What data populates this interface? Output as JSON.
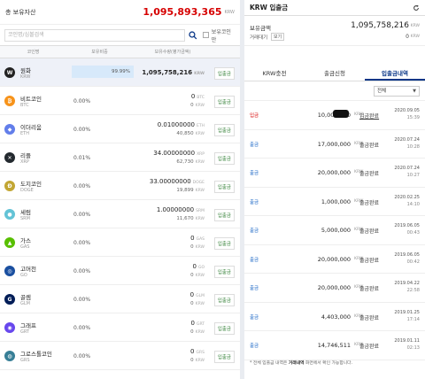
{
  "total": {
    "label": "총 보유자산",
    "amount": "1,095,893,365",
    "unit": "KRW"
  },
  "search": {
    "placeholder": "코인명/심볼검색",
    "checkbox_label": "보유코인만"
  },
  "columns": {
    "name": "코인명",
    "ratio": "보유비중",
    "quantity": "보유수량(평가금액)"
  },
  "deposit_label": "입출금",
  "coins": [
    {
      "name": "원화",
      "symbol": "KRW",
      "ratio": "99.99%",
      "qty": "1,095,758,216",
      "qty_unit": "KRW",
      "krw": "",
      "krw_unit": "",
      "icon_text": "W",
      "color": "#222222"
    },
    {
      "name": "비트코인",
      "symbol": "BTC",
      "ratio": "0.00%",
      "qty": "0",
      "qty_unit": "BTC",
      "krw": "0",
      "krw_unit": "KRW",
      "icon_text": "₿",
      "color": "#f7931a"
    },
    {
      "name": "이더리움",
      "symbol": "ETH",
      "ratio": "0.00%",
      "qty": "0.01000000",
      "qty_unit": "ETH",
      "krw": "40,850",
      "krw_unit": "KRW",
      "icon_text": "◆",
      "color": "#627eea"
    },
    {
      "name": "리플",
      "symbol": "XRP",
      "ratio": "0.01%",
      "qty": "34.00000000",
      "qty_unit": "XRP",
      "krw": "62,730",
      "krw_unit": "KRW",
      "icon_text": "✕",
      "color": "#23292f"
    },
    {
      "name": "도지코인",
      "symbol": "DOGE",
      "ratio": "0.00%",
      "qty": "33.00000000",
      "qty_unit": "DOGE",
      "krw": "19,899",
      "krw_unit": "KRW",
      "icon_text": "Ð",
      "color": "#c2a633"
    },
    {
      "name": "세럼",
      "symbol": "SRM",
      "ratio": "0.00%",
      "qty": "1.00000000",
      "qty_unit": "SRM",
      "krw": "11,670",
      "krw_unit": "KRW",
      "icon_text": "●",
      "color": "#63c3d6"
    },
    {
      "name": "가스",
      "symbol": "GAS",
      "ratio": "0.00%",
      "qty": "0",
      "qty_unit": "GAS",
      "krw": "0",
      "krw_unit": "KRW",
      "icon_text": "▲",
      "color": "#58bf00"
    },
    {
      "name": "고머천",
      "symbol": "GO",
      "ratio": "0.00%",
      "qty": "0",
      "qty_unit": "GO",
      "krw": "0",
      "krw_unit": "KRW",
      "icon_text": "◎",
      "color": "#1a4fa0"
    },
    {
      "name": "골렘",
      "symbol": "GLM",
      "ratio": "0.00%",
      "qty": "0",
      "qty_unit": "GLM",
      "krw": "0",
      "krw_unit": "KRW",
      "icon_text": "G",
      "color": "#001d57"
    },
    {
      "name": "그래프",
      "symbol": "GRT",
      "ratio": "0.00%",
      "qty": "0",
      "qty_unit": "GRT",
      "krw": "0",
      "krw_unit": "KRW",
      "icon_text": "◉",
      "color": "#6747ed"
    },
    {
      "name": "그로스톨코인",
      "symbol": "GRS",
      "ratio": "0.00%",
      "qty": "0",
      "qty_unit": "GRS",
      "krw": "0",
      "krw_unit": "KRW",
      "icon_text": "◍",
      "color": "#377e96"
    }
  ],
  "right": {
    "title": "KRW 입출금",
    "balance_label": "보유금액",
    "balance_value": "1,095,758,216",
    "balance_unit": "KRW",
    "pending_label": "거래대기",
    "pending_view": "보기",
    "pending_value": "0",
    "pending_unit": "KRW",
    "tabs": [
      "KRW충전",
      "출금신청",
      "입출금내역"
    ],
    "filter": "전체",
    "note_prefix": "* 전체 입출금 내역은 ",
    "note_bold": "거래내역",
    "note_suffix": " 화면에서 확인 가능합니다."
  },
  "transactions": [
    {
      "type": "입금",
      "amount": "10,000,000",
      "unit": "KRW",
      "status": "입금완료",
      "date": "2020.09.05",
      "time": "15:39"
    },
    {
      "type": "출금",
      "amount": "17,000,000",
      "unit": "KRW",
      "status": "출금완료",
      "date": "2020.07.24",
      "time": "10:28"
    },
    {
      "type": "출금",
      "amount": "20,000,000",
      "unit": "KRW",
      "status": "출금완료",
      "date": "2020.07.24",
      "time": "10:27"
    },
    {
      "type": "출금",
      "amount": "1,000,000",
      "unit": "KRW",
      "status": "출금완료",
      "date": "2020.02.25",
      "time": "14:10"
    },
    {
      "type": "출금",
      "amount": "5,000,000",
      "unit": "KRW",
      "status": "출금완료",
      "date": "2019.06.05",
      "time": "00:43"
    },
    {
      "type": "출금",
      "amount": "20,000,000",
      "unit": "KRW",
      "status": "출금완료",
      "date": "2019.06.05",
      "time": "00:42"
    },
    {
      "type": "출금",
      "amount": "20,000,000",
      "unit": "KRW",
      "status": "출금완료",
      "date": "2019.04.22",
      "time": "22:58"
    },
    {
      "type": "출금",
      "amount": "4,403,000",
      "unit": "KRW",
      "status": "출금완료",
      "date": "2019.01.25",
      "time": "17:14"
    },
    {
      "type": "출금",
      "amount": "14,746,511",
      "unit": "KRW",
      "status": "출금완료",
      "date": "2019.01.11",
      "time": "02:13"
    }
  ]
}
